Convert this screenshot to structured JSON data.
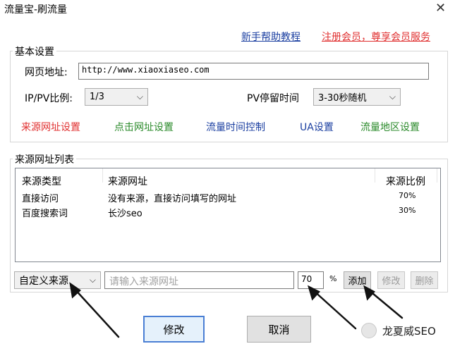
{
  "window": {
    "title": "流量宝-刷流量",
    "close_glyph": "✕"
  },
  "links": {
    "help": "新手帮助教程",
    "register": "注册会员，尊享会员服务"
  },
  "basic": {
    "group_label": "基本设置",
    "url_label": "网页地址:",
    "url_value": "http://www.xiaoxiaseo.com",
    "ippv_label": "IP/PV比例:",
    "ippv_value": "1/3",
    "pv_label": "PV停留时间",
    "pv_value": "3-30秒随机"
  },
  "settings_links": [
    {
      "label": "来源网址设置",
      "color": "#e03030"
    },
    {
      "label": "点击网址设置",
      "color": "#2a8a2a"
    },
    {
      "label": "流量时间控制",
      "color": "#1a3ea0"
    },
    {
      "label": "UA设置",
      "color": "#1a3ea0"
    },
    {
      "label": "流量地区设置",
      "color": "#2a8a2a"
    }
  ],
  "source_list": {
    "group_label": "来源网址列表",
    "columns": [
      "来源类型",
      "来源网址",
      "来源比例"
    ],
    "rows": [
      {
        "type": "直接访问",
        "url": "没有来源，直接访问填写的网址",
        "ratio": "70%"
      },
      {
        "type": "百度搜索词",
        "url": "长沙seo",
        "ratio": "30%"
      }
    ]
  },
  "source_controls": {
    "type_value": "自定义来源",
    "url_placeholder": "请输入来源网址",
    "ratio_value": "70",
    "percent": "%",
    "add": "添加",
    "modify": "修改",
    "delete": "删除"
  },
  "footer": {
    "modify": "修改",
    "cancel": "取消",
    "watermark": "龙夏威SEO"
  }
}
